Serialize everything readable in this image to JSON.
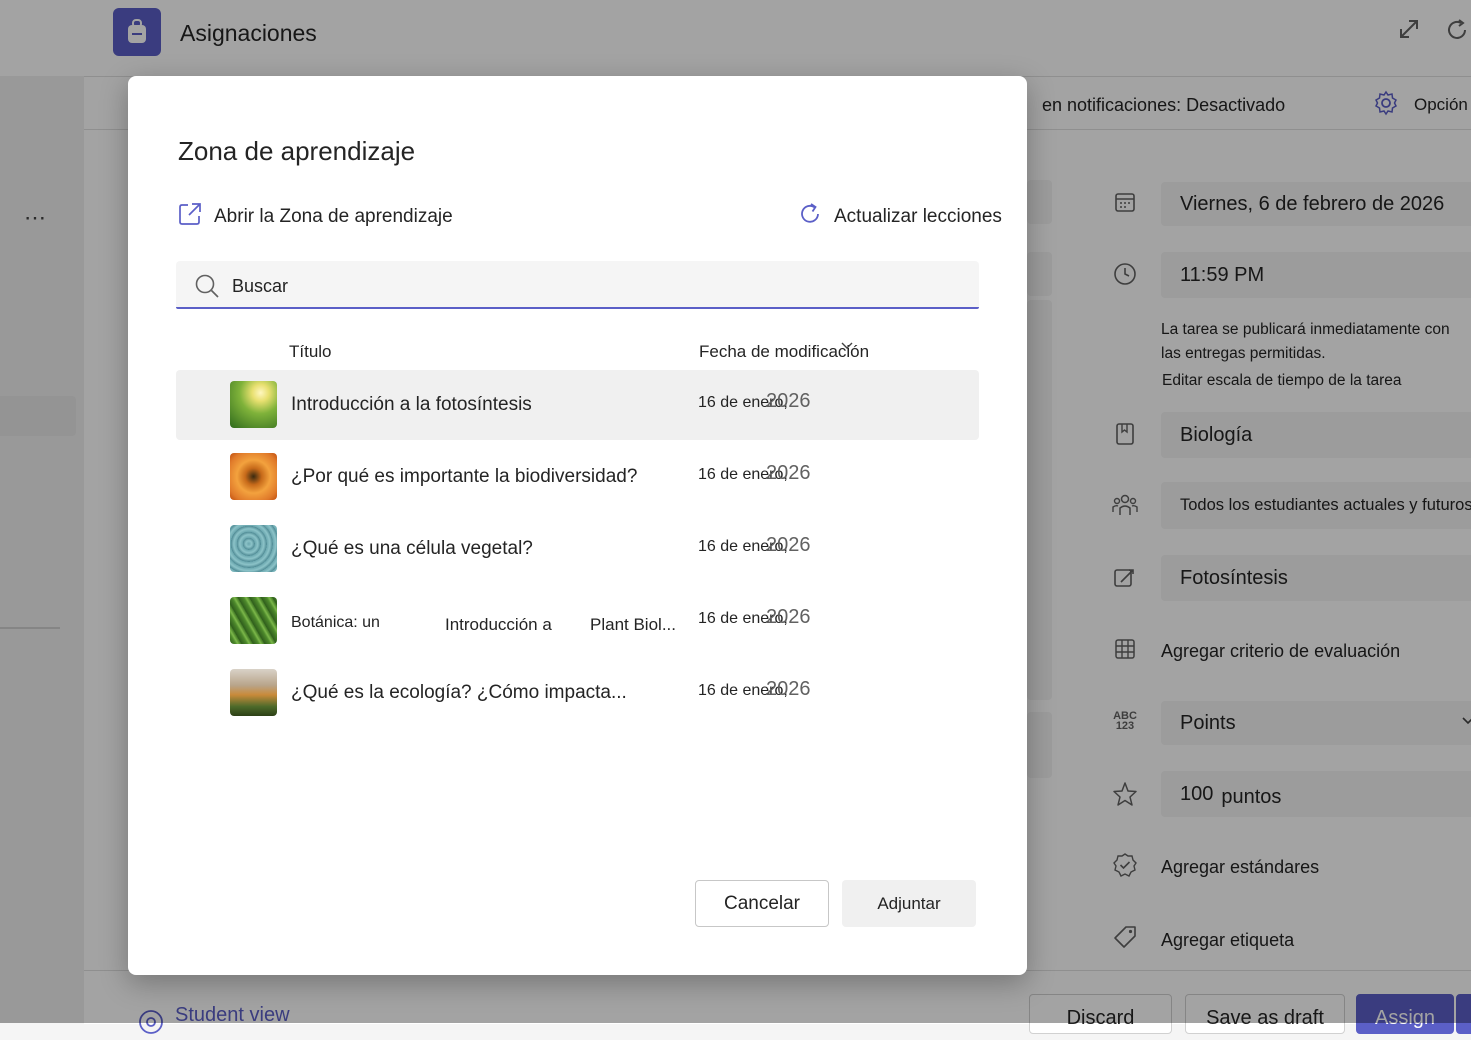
{
  "app": {
    "title": "Asignaciones",
    "expand_icon": "expand-icon",
    "refresh_icon": "refresh-icon"
  },
  "subbar": {
    "notifications_text": "en notificaciones: Desactivado",
    "options_label": "Opción"
  },
  "left_rail": {
    "more_label": "⋯"
  },
  "right_panel": {
    "due_date": "Viernes, 6 de febrero de 2026",
    "due_time": "11:59 PM",
    "publish_note": "La tarea se publicará inmediatamente con las entregas permitidas.",
    "edit_timeline_link": "Editar escala de tiempo de la tarea",
    "class_name": "Biología",
    "assign_to": "Todos los estudiantes actuales y futuros",
    "category": "Fotosíntesis",
    "add_rubric": "Agregar criterio de evaluación",
    "grading_type": "Points",
    "points_value": "100",
    "points_label": "puntos",
    "add_standards": "Agregar estándares",
    "add_tag": "Agregar etiqueta"
  },
  "footer": {
    "student_view": "Student view",
    "discard": "Discard",
    "save_draft": "Save as draft",
    "assign": "Assign"
  },
  "dialog": {
    "title": "Zona de aprendizaje",
    "open_link": "Abrir la Zona de aprendizaje",
    "refresh_link": "Actualizar lecciones",
    "search_placeholder": "Buscar",
    "col_title": "Título",
    "col_date": "Fecha de modificación",
    "rows": [
      {
        "title": "Introducción a la fotosíntesis",
        "date": "16 de enero,",
        "year": "2026",
        "selected": true
      },
      {
        "title": "¿Por qué es importante la biodiversidad?",
        "date": "16 de enero,",
        "year": "2026",
        "selected": false
      },
      {
        "title": "¿Qué es una célula vegetal?",
        "date": "16 de enero,",
        "year": "2026",
        "selected": false
      },
      {
        "title_a": "Botánica: un",
        "title_b": "Introducción a",
        "title_c": "Plant Biol...",
        "date": "16 de enero,",
        "year": "2026",
        "selected": false
      },
      {
        "title": "¿Qué es la ecología? ¿Cómo impacta...",
        "date": "16 de enero,",
        "year": "2026",
        "selected": false
      }
    ],
    "cancel": "Cancelar",
    "attach": "Adjuntar"
  },
  "colors": {
    "accent": "#5b5fc7"
  }
}
